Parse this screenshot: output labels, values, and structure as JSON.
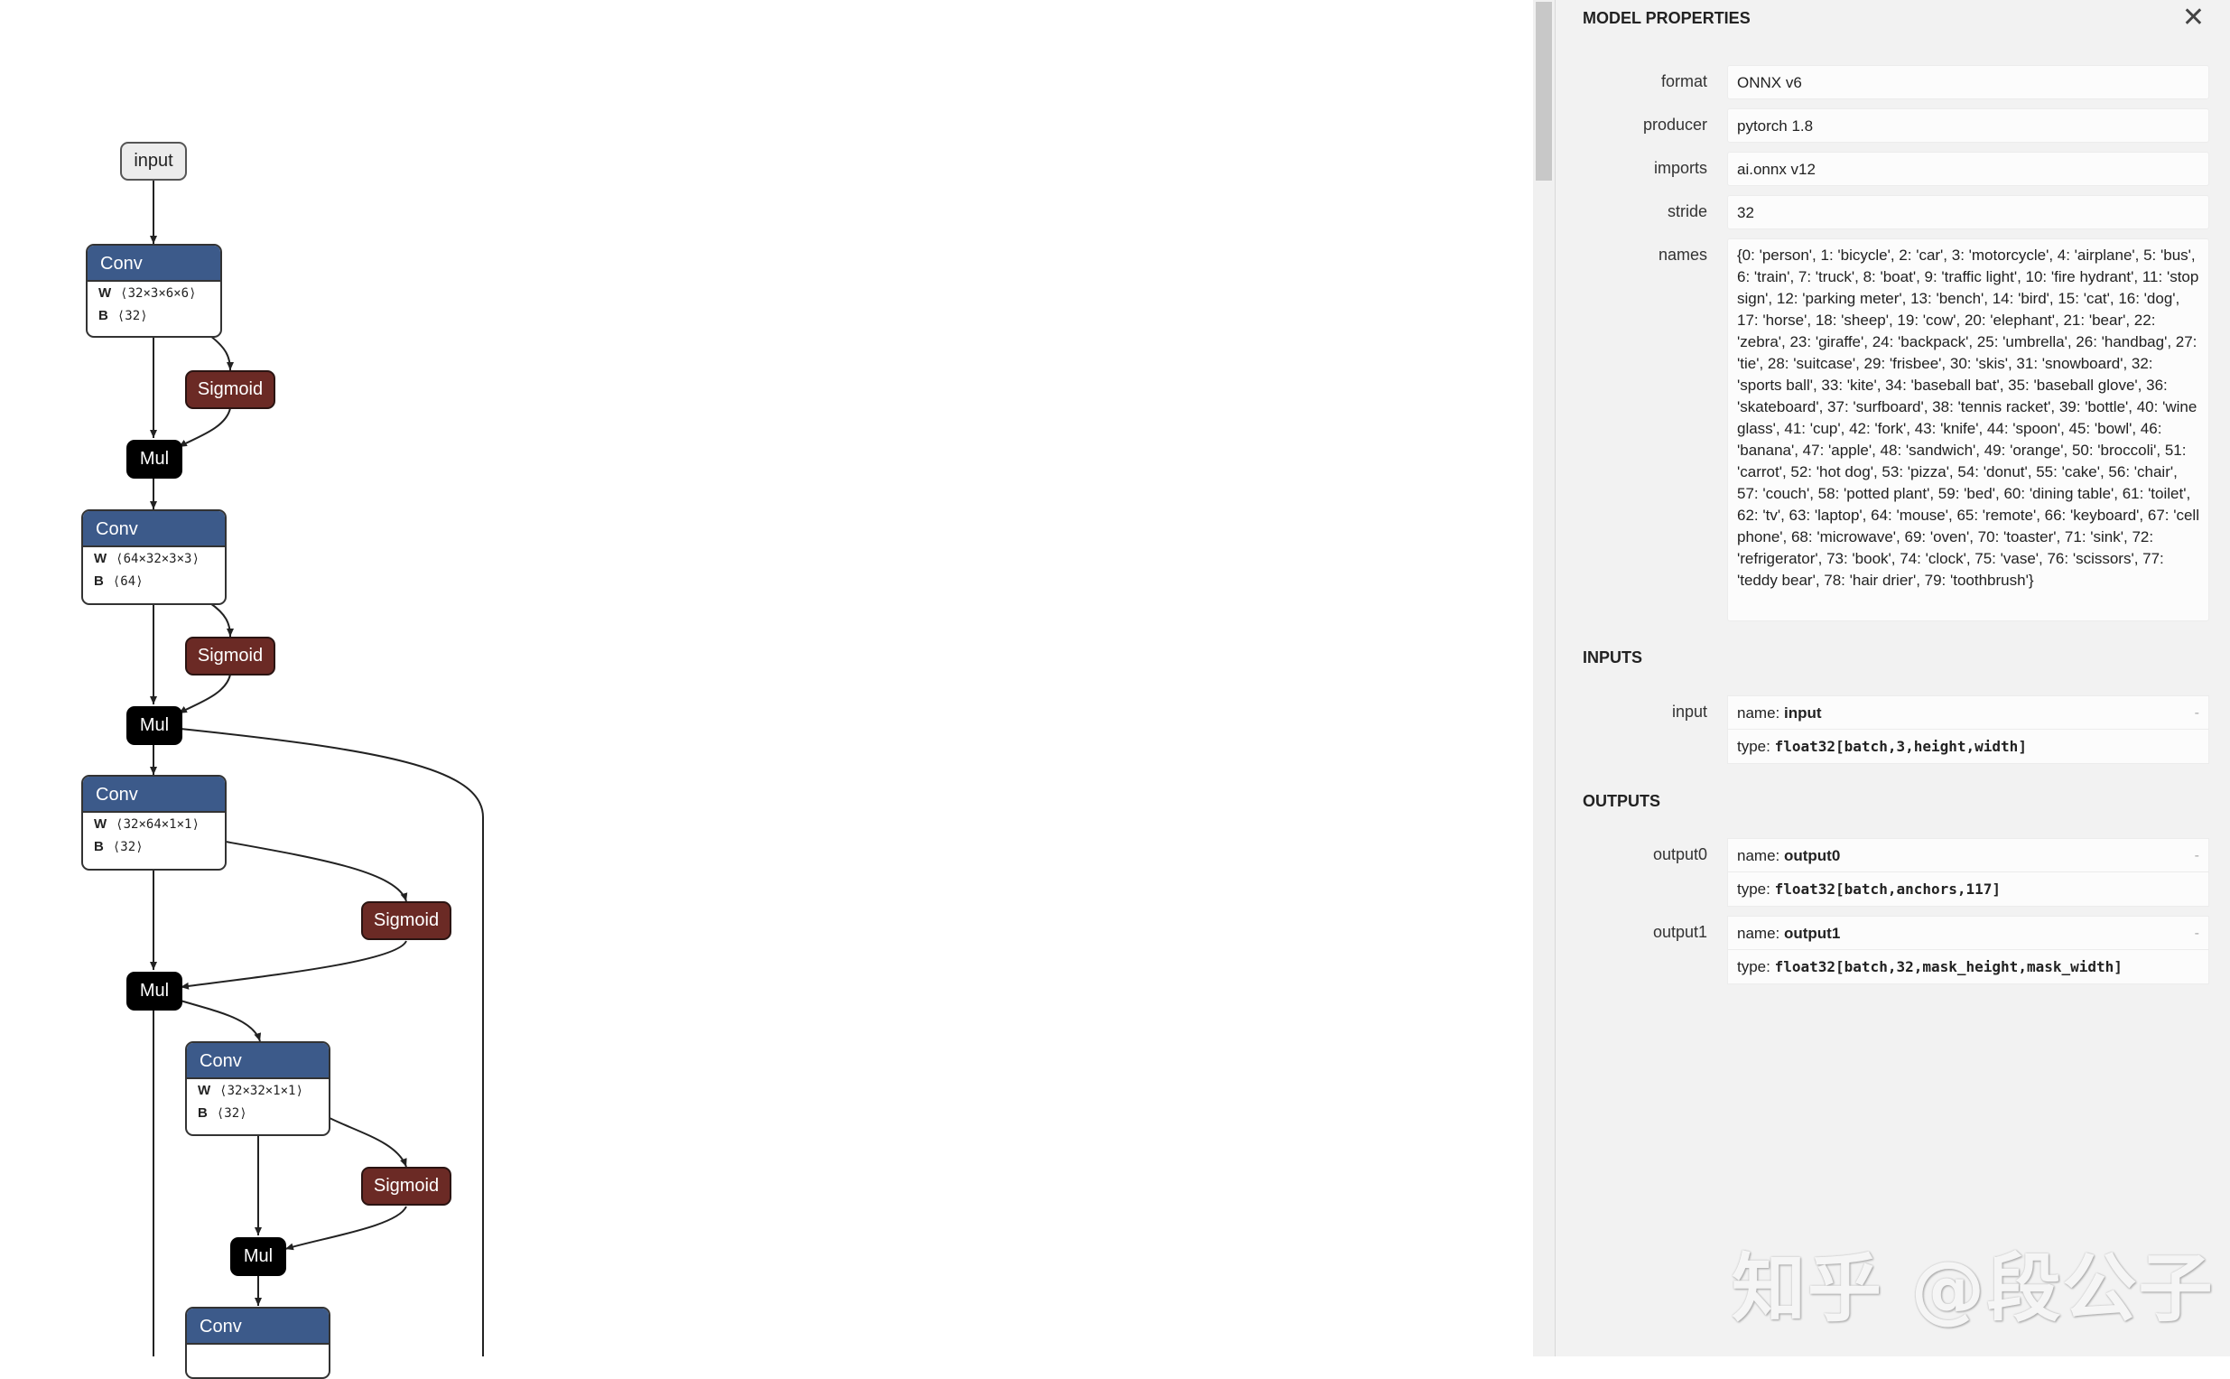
{
  "graph": {
    "input_label": "input",
    "nodes": [
      {
        "type": "Conv",
        "w": "⟨32×3×6×6⟩",
        "b": "⟨32⟩"
      },
      {
        "type": "Sigmoid"
      },
      {
        "type": "Mul"
      },
      {
        "type": "Conv",
        "w": "⟨64×32×3×3⟩",
        "b": "⟨64⟩"
      },
      {
        "type": "Sigmoid"
      },
      {
        "type": "Mul"
      },
      {
        "type": "Conv",
        "w": "⟨32×64×1×1⟩",
        "b": "⟨32⟩"
      },
      {
        "type": "Sigmoid"
      },
      {
        "type": "Mul"
      },
      {
        "type": "Conv",
        "w": "⟨32×32×1×1⟩",
        "b": "⟨32⟩"
      },
      {
        "type": "Sigmoid"
      },
      {
        "type": "Mul"
      },
      {
        "type": "Conv"
      }
    ],
    "attr_w_label": "W",
    "attr_b_label": "B"
  },
  "sidebar": {
    "title": "MODEL PROPERTIES",
    "close_icon": "close-icon",
    "properties": [
      {
        "label": "format",
        "value": "ONNX v6"
      },
      {
        "label": "producer",
        "value": "pytorch 1.8"
      },
      {
        "label": "imports",
        "value": "ai.onnx v12"
      },
      {
        "label": "stride",
        "value": "32"
      },
      {
        "label": "names",
        "value": "{0: 'person', 1: 'bicycle', 2: 'car', 3: 'motorcycle', 4: 'airplane', 5: 'bus', 6: 'train', 7: 'truck', 8: 'boat', 9: 'traffic light', 10: 'fire hydrant', 11: 'stop sign', 12: 'parking meter', 13: 'bench', 14: 'bird', 15: 'cat', 16: 'dog', 17: 'horse', 18: 'sheep', 19: 'cow', 20: 'elephant', 21: 'bear', 22: 'zebra', 23: 'giraffe', 24: 'backpack', 25: 'umbrella', 26: 'handbag', 27: 'tie', 28: 'suitcase', 29: 'frisbee', 30: 'skis', 31: 'snowboard', 32: 'sports ball', 33: 'kite', 34: 'baseball bat', 35: 'baseball glove', 36: 'skateboard', 37: 'surfboard', 38: 'tennis racket', 39: 'bottle', 40: 'wine glass', 41: 'cup', 42: 'fork', 43: 'knife', 44: 'spoon', 45: 'bowl', 46: 'banana', 47: 'apple', 48: 'sandwich', 49: 'orange', 50: 'broccoli', 51: 'carrot', 52: 'hot dog', 53: 'pizza', 54: 'donut', 55: 'cake', 56: 'chair', 57: 'couch', 58: 'potted plant', 59: 'bed', 60: 'dining table', 61: 'toilet', 62: 'tv', 63: 'laptop', 64: 'mouse', 65: 'remote', 66: 'keyboard', 67: 'cell phone', 68: 'microwave', 69: 'oven', 70: 'toaster', 71: 'sink', 72: 'refrigerator', 73: 'book', 74: 'clock', 75: 'vase', 76: 'scissors', 77: 'teddy bear', 78: 'hair drier', 79: 'toothbrush'}"
      }
    ],
    "inputs_title": "INPUTS",
    "inputs": [
      {
        "label": "input",
        "name_prefix": "name:",
        "name": "input",
        "type_prefix": "type:",
        "type": "float32[batch,3,height,width]",
        "expand": "-"
      }
    ],
    "outputs_title": "OUTPUTS",
    "outputs": [
      {
        "label": "output0",
        "name_prefix": "name:",
        "name": "output0",
        "type_prefix": "type:",
        "type": "float32[batch,anchors,117]",
        "expand": "-"
      },
      {
        "label": "output1",
        "name_prefix": "name:",
        "name": "output1",
        "type_prefix": "type:",
        "type": "float32[batch,32,mask_height,mask_width]",
        "expand": "-"
      }
    ]
  },
  "watermark": "知乎 @段公子",
  "colors": {
    "conv_header": "#3c5a8a",
    "sigmoid": "#6b2a25",
    "mul": "#000000",
    "sidebar_bg": "#f2f2f2"
  }
}
